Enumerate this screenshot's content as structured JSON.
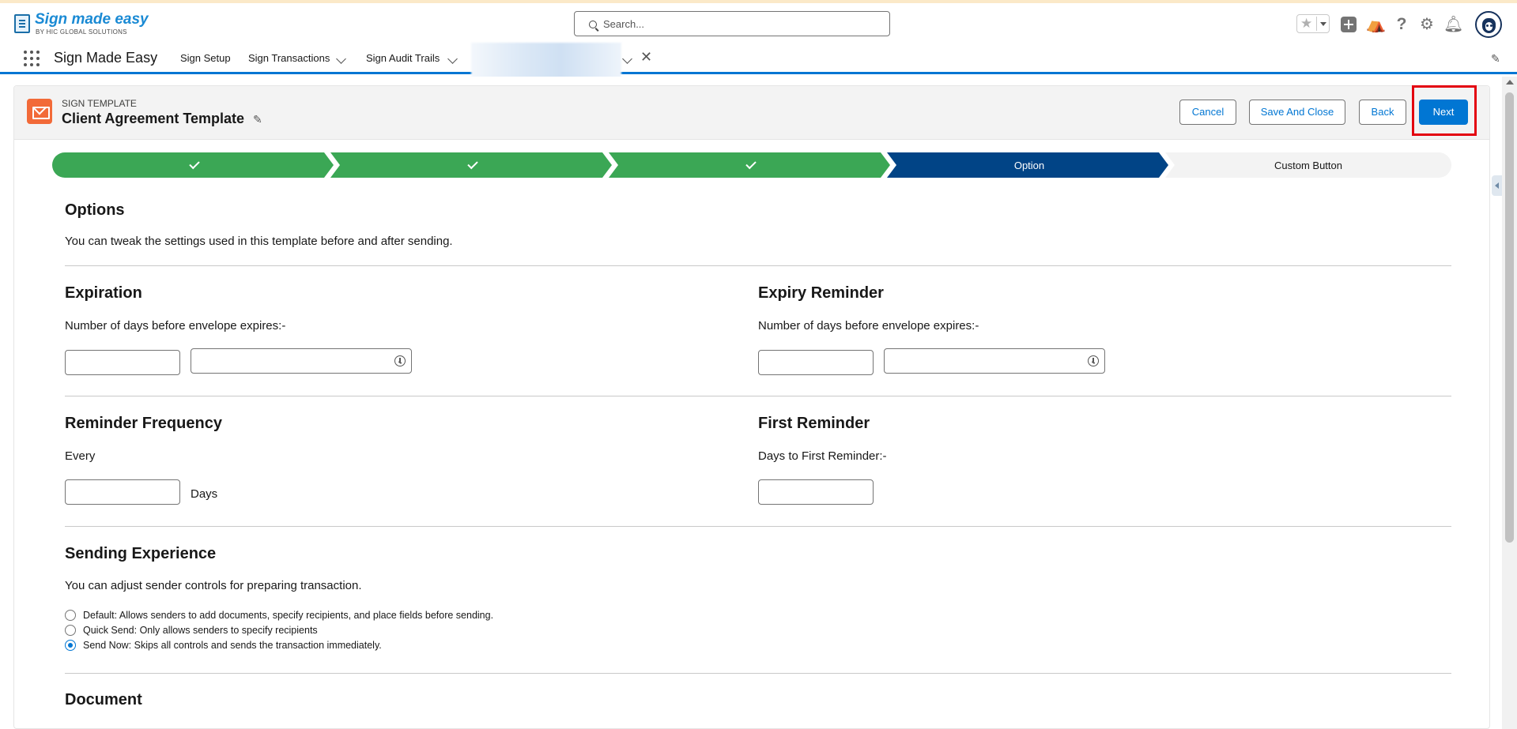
{
  "branding": {
    "logo_title": "Sign made easy",
    "logo_subtitle": "BY HIC GLOBAL SOLUTIONS"
  },
  "search": {
    "placeholder": "Search..."
  },
  "nav": {
    "app_name": "Sign Made Easy",
    "items": [
      {
        "label": "Sign Setup"
      },
      {
        "label": "Sign Transactions"
      },
      {
        "label": "Sign Audit Trails"
      }
    ]
  },
  "card": {
    "eyebrow": "SIGN TEMPLATE",
    "title": "Client Agreement Template",
    "buttons": {
      "cancel": "Cancel",
      "save_close": "Save And Close",
      "back": "Back",
      "next": "Next"
    }
  },
  "path": {
    "steps": [
      {
        "label": "",
        "status": "complete"
      },
      {
        "label": "",
        "status": "complete"
      },
      {
        "label": "",
        "status": "complete"
      },
      {
        "label": "Option",
        "status": "current"
      },
      {
        "label": "Custom Button",
        "status": "incomplete"
      }
    ]
  },
  "options": {
    "heading": "Options",
    "description": "You can tweak the settings used in this template before and after sending."
  },
  "expiration": {
    "heading": "Expiration",
    "label": "Number of days before envelope expires:-",
    "days_value": "",
    "time_value": ""
  },
  "expiry_reminder": {
    "heading": "Expiry Reminder",
    "label": "Number of days before envelope expires:-",
    "days_value": "",
    "time_value": ""
  },
  "reminder_frequency": {
    "heading": "Reminder Frequency",
    "every_label": "Every",
    "value": "",
    "unit": "Days"
  },
  "first_reminder": {
    "heading": "First Reminder",
    "label": "Days to First Reminder:-",
    "value": ""
  },
  "sending_experience": {
    "heading": "Sending Experience",
    "description": "You can adjust sender controls for preparing transaction.",
    "options": [
      {
        "label": "Default: Allows senders to add documents, specify recipients, and place fields before sending.",
        "checked": false
      },
      {
        "label": "Quick Send: Only allows senders to specify recipients",
        "checked": false
      },
      {
        "label": "Send Now: Skips all controls and sends the transaction immediately.",
        "checked": true
      }
    ]
  },
  "document": {
    "heading": "Document"
  },
  "colors": {
    "brand_blue": "#0176d3",
    "complete_green": "#3ba755",
    "current_navy": "#014486",
    "highlight_red": "#e3000f",
    "template_icon": "#f26a38"
  },
  "icons": [
    "search-icon",
    "star-icon",
    "add-icon",
    "trailhead-icon",
    "help-icon",
    "gear-icon",
    "bell-icon",
    "app-launcher-icon",
    "chevron-down-icon",
    "close-icon",
    "edit-pencil-icon",
    "email-template-icon",
    "check-icon",
    "clock-icon"
  ]
}
